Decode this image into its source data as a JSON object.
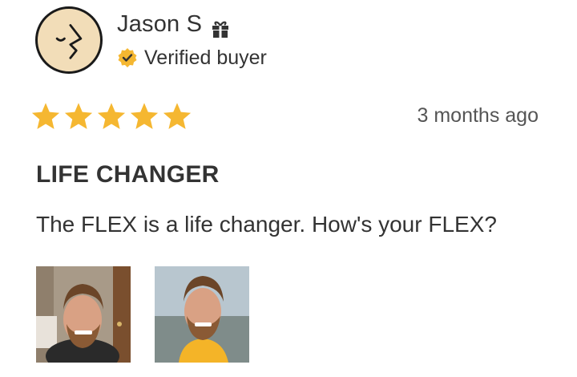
{
  "reviewer": {
    "name": "Jason S",
    "verified_label": "Verified buyer",
    "avatar_icon": "face-profile-icon",
    "badge_icon": "verified-check-icon",
    "gift_icon": "gift-icon"
  },
  "review": {
    "rating": 5,
    "rating_max": 5,
    "date": "3 months ago",
    "title": "LIFE CHANGER",
    "body": "The FLEX is a life changer. How's your FLEX?"
  },
  "photos": [
    {
      "icon": "review-photo-1"
    },
    {
      "icon": "review-photo-2"
    }
  ],
  "colors": {
    "star": "#f5b731",
    "badge": "#f5b731",
    "avatar_bg": "#f2ddb8",
    "text": "#333333"
  }
}
